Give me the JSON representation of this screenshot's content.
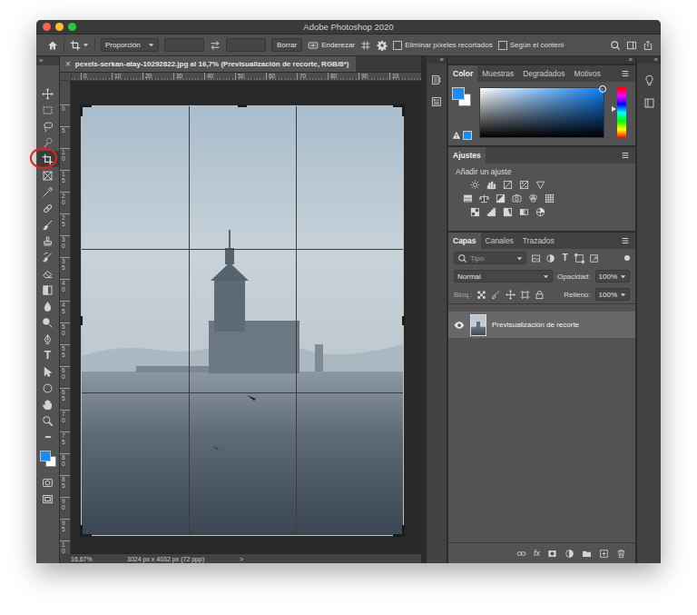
{
  "window": {
    "title": "Adobe Photoshop 2020"
  },
  "options_bar": {
    "aspect": "Proporción",
    "clear_button": "Borrar",
    "straighten": "Enderezar",
    "checkboxes": [
      {
        "label": "Eliminar píxeles recortados",
        "checked": false
      },
      {
        "label": "Según el conteni",
        "checked": false
      }
    ]
  },
  "toolbar": {
    "collapse": "»",
    "tools": [
      {
        "kind": "move",
        "selected": false,
        "highlighted": false
      },
      {
        "kind": "marquee",
        "selected": false,
        "highlighted": false
      },
      {
        "kind": "lasso",
        "selected": false,
        "highlighted": false
      },
      {
        "kind": "quickselect",
        "selected": false,
        "highlighted": false
      },
      {
        "kind": "crop",
        "selected": true,
        "highlighted": true
      },
      {
        "kind": "frame",
        "selected": false,
        "highlighted": false
      },
      {
        "kind": "eyedropper",
        "selected": false,
        "highlighted": false
      },
      {
        "kind": "healing",
        "selected": false,
        "highlighted": false
      },
      {
        "kind": "brush",
        "selected": false,
        "highlighted": false
      },
      {
        "kind": "stamp",
        "selected": false,
        "highlighted": false
      },
      {
        "kind": "history",
        "selected": false,
        "highlighted": false
      },
      {
        "kind": "eraser",
        "selected": false,
        "highlighted": false
      },
      {
        "kind": "gradient",
        "selected": false,
        "highlighted": false
      },
      {
        "kind": "blur",
        "selected": false,
        "highlighted": false
      },
      {
        "kind": "dodge",
        "selected": false,
        "highlighted": false
      },
      {
        "kind": "pen",
        "selected": false,
        "highlighted": false
      },
      {
        "kind": "type",
        "glyph": "T",
        "selected": false,
        "highlighted": false
      },
      {
        "kind": "pathselect",
        "selected": false,
        "highlighted": false
      },
      {
        "kind": "shape",
        "selected": false,
        "highlighted": false
      },
      {
        "kind": "hand",
        "selected": false,
        "highlighted": false
      },
      {
        "kind": "zoom",
        "selected": false,
        "highlighted": false
      },
      {
        "kind": "more",
        "glyph": "•••",
        "selected": false,
        "highlighted": false
      }
    ],
    "foreground": "#1b8cf2",
    "background": "#ffffff"
  },
  "document": {
    "close": "×",
    "tab": "pexels-serkan-atay-10292822.jpg al 16,7% (Previsualización de recorte, RGB/8*)",
    "ruler_top": [
      "0",
      "10",
      "20",
      "30",
      "40",
      "50",
      "60",
      "70",
      "80",
      "90",
      "10"
    ],
    "ruler_left": [
      "0",
      "5",
      "10",
      "15",
      "20",
      "25",
      "30",
      "35",
      "40",
      "45",
      "50",
      "55",
      "60",
      "65",
      "70",
      "75",
      "80",
      "85",
      "90",
      "95",
      "10"
    ]
  },
  "status_bar": {
    "zoom": "16,67%",
    "info": "3024 px x 4032 px (72 ppp)",
    "arrow": ">"
  },
  "dock": {
    "left": "«",
    "panels": "»",
    "right": "«"
  },
  "color_panel": {
    "tabs": [
      {
        "label": "Color",
        "selected": true
      },
      {
        "label": "Muestras",
        "selected": false
      },
      {
        "label": "Degradados",
        "selected": false
      },
      {
        "label": "Motivos",
        "selected": false
      }
    ],
    "foreground": "#1b8cf2",
    "background": "#ffffff",
    "hue": "#0a7df5",
    "hue_level": 0.42
  },
  "adjustments_panel": {
    "title": "Ajustes",
    "subtitle": "Añadir un ajuste"
  },
  "layers_panel": {
    "tabs": [
      {
        "label": "Capas",
        "selected": true
      },
      {
        "label": "Canales",
        "selected": false
      },
      {
        "label": "Trazados",
        "selected": false
      }
    ],
    "search_placeholder": "Tipo",
    "filter_glyph": "T",
    "blend_mode": "Normal",
    "opacity_label": "Opacidad:",
    "opacity": "100%",
    "lock_label": "Bloq.:",
    "fill_label": "Relleno:",
    "fill": "100%",
    "layers": [
      {
        "name": "Previsualización de recorte",
        "visible": true,
        "selected": true
      }
    ],
    "footer_glyph": "fx"
  }
}
